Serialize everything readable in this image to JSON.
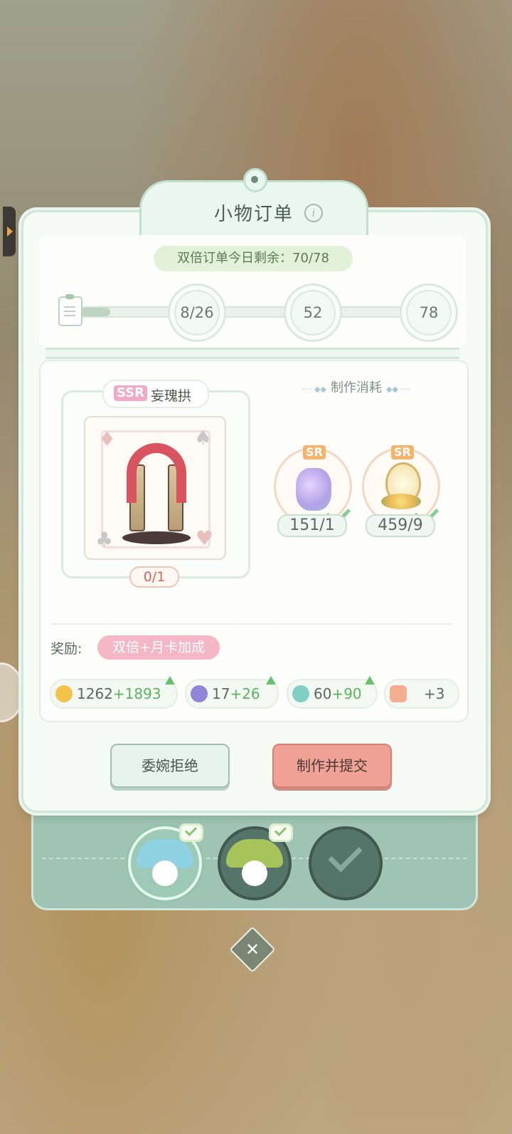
{
  "title": "小物订单",
  "double_orders": "双倍订单今日剩余：70/78",
  "progress": {
    "value": 8,
    "max": 78,
    "fraction": 0.1
  },
  "milestones": [
    "8/26",
    "52",
    "78"
  ],
  "item": {
    "rarity": "SSR",
    "name": "妄瑰拱",
    "count": "0/1"
  },
  "materials_label": "制作消耗",
  "materials": [
    {
      "rarity": "SR",
      "count": "151/1",
      "icon": "crystal-flower-bundle-icon"
    },
    {
      "rarity": "SR",
      "count": "459/9",
      "icon": "mirror-bouquet-icon"
    }
  ],
  "reward_label": "奖励:",
  "reward_bonus": "双倍+月卡加成",
  "rewards": [
    {
      "base": "1262",
      "plus": "+1893",
      "icon": "coin-icon",
      "color": "#f2c24a"
    },
    {
      "base": "17",
      "plus": "+26",
      "icon": "gem-icon",
      "color": "#8f86d9"
    },
    {
      "base": "60",
      "plus": "+90",
      "icon": "exp-icon",
      "color": "#7fcfc4"
    },
    {
      "base": "+3",
      "plus": "",
      "icon": "ticket-icon",
      "color": "#f4b08e"
    }
  ],
  "buttons": {
    "decline": "委婉拒绝",
    "submit": "制作并提交"
  },
  "colors": {
    "accent": "#9fc4b5",
    "submit": "#f0a296",
    "positive": "#58b55d"
  }
}
